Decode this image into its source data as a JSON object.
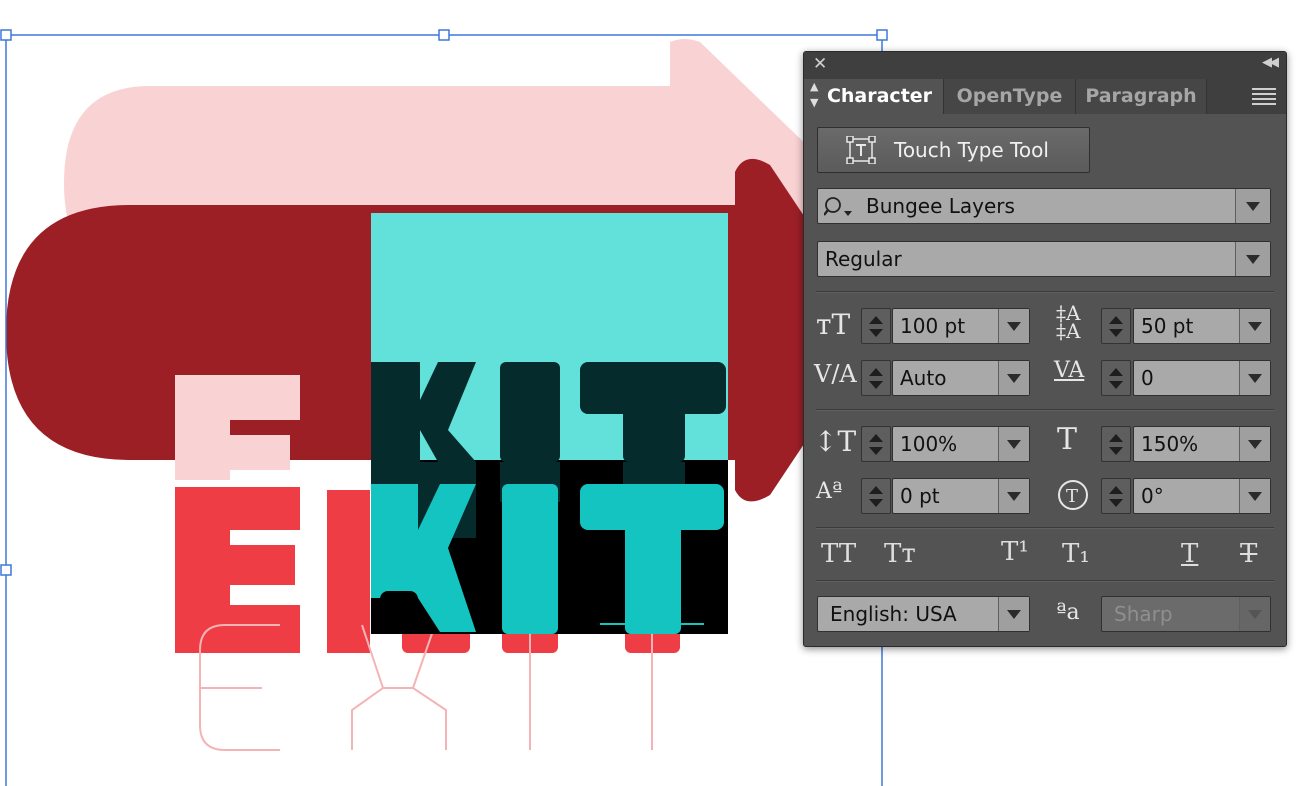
{
  "canvas": {
    "artwork_word": "EXIT",
    "colors": {
      "pink_light": "#f9d2d3",
      "maroon": "#9c1f26",
      "red": "#ef3d45",
      "teal_light": "#62e0da",
      "teal": "#14c4c1",
      "dark_teal": "#062b2c",
      "black": "#000000",
      "selection_blue": "#3d78d8"
    }
  },
  "panel": {
    "tabs": [
      {
        "label": "Character",
        "active": true
      },
      {
        "label": "OpenType",
        "active": false
      },
      {
        "label": "Paragraph",
        "active": false
      }
    ],
    "touch_type_button": "Touch Type Tool",
    "font_family": "Bungee Layers",
    "font_style": "Regular",
    "font_size": "100 pt",
    "leading": "50 pt",
    "kerning": "Auto",
    "tracking": "0",
    "vertical_scale": "100%",
    "horizontal_scale": "150%",
    "baseline_shift": "0 pt",
    "rotation": "0°",
    "language": "English: USA",
    "anti_aliasing": "Sharp",
    "icons": {
      "close": "close-icon",
      "collapse": "collapse-icon",
      "menu": "panel-menu-icon"
    },
    "colors": {
      "panel_bg": "#535353",
      "field_bg": "#a9a9a9",
      "tab_bar": "#3f3f3f"
    }
  }
}
